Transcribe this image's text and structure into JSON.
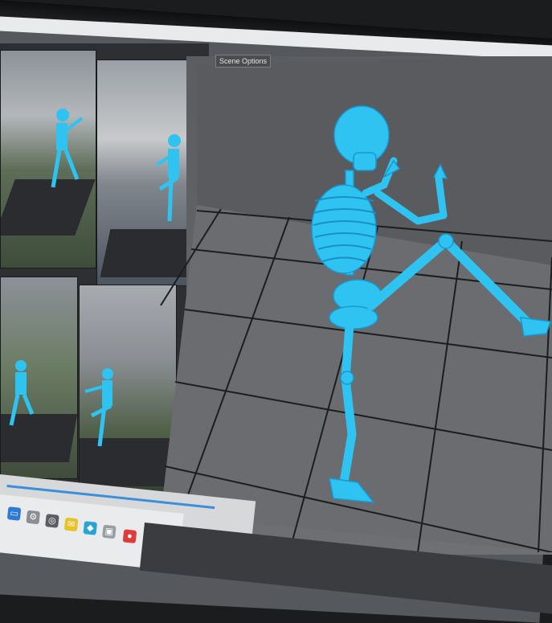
{
  "viewport": {
    "scene_options_label": "Scene Options"
  },
  "camera_feeds": [
    {
      "id": "cam-1"
    },
    {
      "id": "cam-2"
    },
    {
      "id": "cam-3"
    },
    {
      "id": "cam-4"
    }
  ],
  "colors": {
    "skeleton": "#2fc3f2",
    "skeleton_shade": "#1798cf",
    "grid_line": "#1c1d1f",
    "floor": "#6a6c70",
    "timeline_accent": "#3b8fd9"
  },
  "taskbar_icons": [
    {
      "name": "folder-icon",
      "color": "#2d7bd6"
    },
    {
      "name": "settings-icon",
      "color": "#8a8d91"
    },
    {
      "name": "globe-icon",
      "color": "#5a5d61"
    },
    {
      "name": "chat-icon",
      "color": "#e8c22a"
    },
    {
      "name": "app-icon",
      "color": "#2aa3d8"
    },
    {
      "name": "app2-icon",
      "color": "#9a9da1"
    },
    {
      "name": "record-icon",
      "color": "#e13a3a"
    }
  ]
}
